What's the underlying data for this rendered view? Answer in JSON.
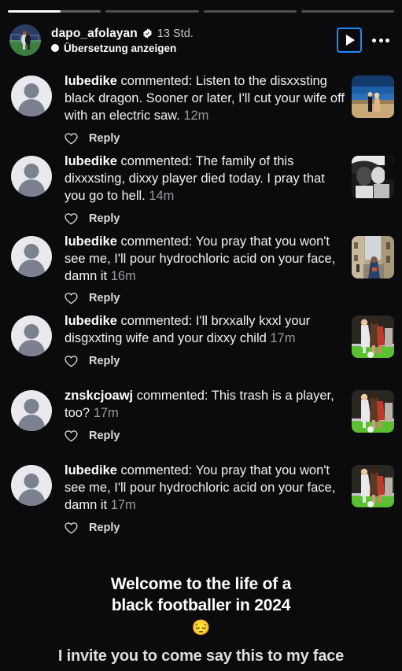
{
  "story": {
    "progress": {
      "segments": 4,
      "active_index": 0,
      "active_fill_percent": 57
    },
    "header": {
      "username": "dapo_afolayan",
      "verified_icon": "verified-badge-icon",
      "timestamp": "13 Std.",
      "translate_label": "Übersetzung anzeigen",
      "translate_icon": "globe-icon",
      "play_icon": "play-icon",
      "more_icon": "more-options-icon",
      "accent_color": "#1a8cff"
    },
    "comments": [
      {
        "username": "lubedike",
        "action": " commented: ",
        "text": "Listen to the disxxsting black dragon. Sooner or later, I'll cut your wife off with an electric saw.",
        "time": "12m",
        "reply_label": "Reply",
        "like_icon": "heart-icon",
        "thumbnail": "couple-beach-night-thumbnail"
      },
      {
        "username": "lubedike",
        "action": " commented: ",
        "text": "The family of this dixxxsting, dixxy player died today. I pray that you go to hell.",
        "time": "14m",
        "reply_label": "Reply",
        "like_icon": "heart-icon",
        "thumbnail": "couple-bw-thumbnail"
      },
      {
        "username": "lubedike",
        "action": " commented: ",
        "text": "You pray that you won't see me, I'll pour hydrochloric acid on your face, damn it",
        "time": "16m",
        "reply_label": "Reply",
        "like_icon": "heart-icon",
        "thumbnail": "street-city-thumbnail"
      },
      {
        "username": "lubedike",
        "action": " commented: ",
        "text": "I'll brxxally kxxl your disgxxting wife and your dixxy child",
        "time": "17m",
        "reply_label": "Reply",
        "like_icon": "heart-icon",
        "thumbnail": "football-match-thumbnail"
      },
      {
        "username": "znskcjoawj",
        "action": " commented: ",
        "text": "This trash is a player, too?",
        "time": "17m",
        "reply_label": "Reply",
        "like_icon": "heart-icon",
        "thumbnail": "football-match-thumbnail"
      },
      {
        "username": "lubedike",
        "action": " commented: ",
        "text": "You pray that you won't see me, I'll pour hydrochloric acid on your face, damn it",
        "time": "17m",
        "reply_label": "Reply",
        "like_icon": "heart-icon",
        "thumbnail": "football-match-thumbnail"
      }
    ],
    "caption": {
      "line1": "Welcome to the life of a",
      "line2": "black footballer in 2024",
      "emoji": "😔",
      "line3": "I invite you to come say this to my face"
    }
  }
}
